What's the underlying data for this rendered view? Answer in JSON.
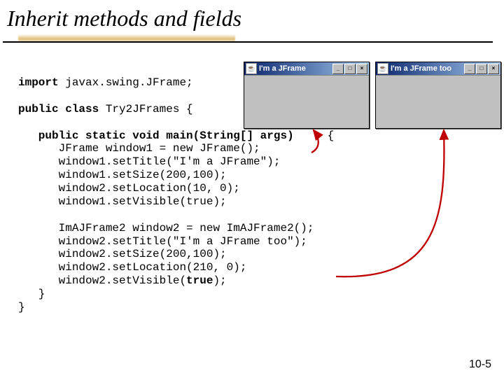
{
  "title": "Inherit methods and fields",
  "page_number": "10-5",
  "windows": {
    "win1": {
      "title": "I'm a JFrame"
    },
    "win2": {
      "title": "I'm a JFrame too"
    }
  },
  "window_buttons": {
    "min": "_",
    "max": "□",
    "close": "×"
  },
  "code": {
    "l1a": "import",
    "l1b": " javax.swing.JFrame;",
    "l2a": "public class",
    "l2b": " Try2JFrames {",
    "l3a": "   public static void main(String[] args)",
    "l3b": "     {",
    "l4": "      JFrame window1 = new JFrame();",
    "l5": "      window1.setTitle(\"I'm a JFrame\");",
    "l6": "      window1.setSize(200,100);",
    "l7": "      window2.setLocation(10, 0);",
    "l8": "      window1.setVisible(true);",
    "l9": "      ImAJFrame2 window2 = new ImAJFrame2();",
    "l10": "      window2.setTitle(\"I'm a JFrame too\");",
    "l11": "      window2.setSize(200,100);",
    "l12": "      window2.setLocation(210, 0);",
    "l13a": "      window2.setVisible(",
    "l13b": "true",
    "l13c": ");",
    "l14": "   }",
    "l15": "}"
  }
}
